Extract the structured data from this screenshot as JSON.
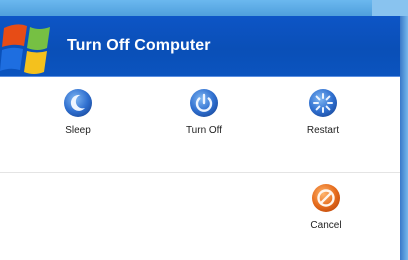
{
  "window": {
    "title": "Turn Off Computer",
    "logo_icon": "windows-logo-icon"
  },
  "options": [
    {
      "label": "Sleep",
      "icon": "moon-icon",
      "color": "#2f6fcf"
    },
    {
      "label": "Turn Off",
      "icon": "power-icon",
      "color": "#2f6fcf"
    },
    {
      "label": "Restart",
      "icon": "restart-icon",
      "color": "#2f6fcf"
    }
  ],
  "cancel": {
    "label": "Cancel",
    "icon": "cancel-icon",
    "color": "#e56b1c"
  },
  "colors": {
    "titlebar": "#0b54bf",
    "background": "#58a8e3"
  }
}
